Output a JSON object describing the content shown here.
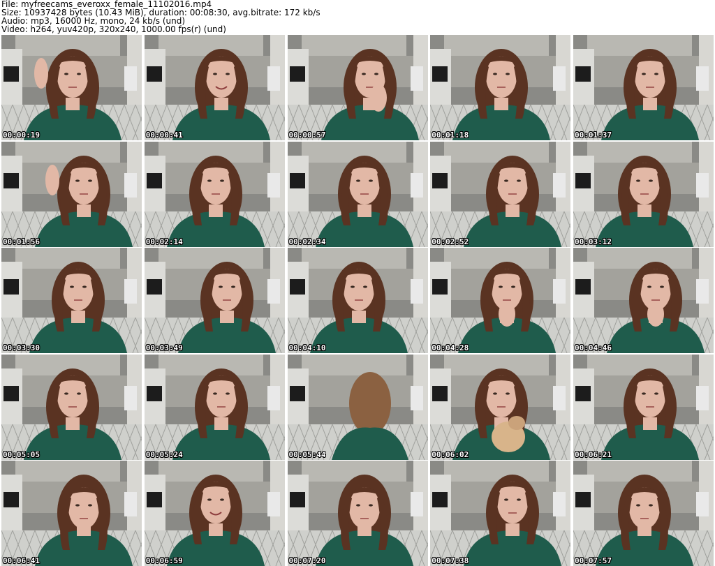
{
  "header": {
    "file_line": "File: myfreecams_everoxx_female_11102016.mp4",
    "size_line": "Size: 10937428 bytes (10.43 MiB), duration: 00:08:30, avg.bitrate: 172 kb/s",
    "audio_line": "Audio: mp3, 16000 Hz, mono, 24 kb/s (und)",
    "video_line": "Video: h264, yuv420p, 320x240, 1000.00 fps(r) (und)"
  },
  "thumbnails": [
    {
      "timestamp": "00:00:19",
      "pose": "hand-raised-left"
    },
    {
      "timestamp": "00:00:41",
      "pose": "smiling"
    },
    {
      "timestamp": "00:00:57",
      "pose": "hand-on-face"
    },
    {
      "timestamp": "00:01:18",
      "pose": "frown"
    },
    {
      "timestamp": "00:01:37",
      "pose": "side-glance"
    },
    {
      "timestamp": "00:01:56",
      "pose": "hand-on-head"
    },
    {
      "timestamp": "00:02:14",
      "pose": "looking-down"
    },
    {
      "timestamp": "00:02:34",
      "pose": "looking-down"
    },
    {
      "timestamp": "00:02:52",
      "pose": "looking-down"
    },
    {
      "timestamp": "00:03:12",
      "pose": "looking-down"
    },
    {
      "timestamp": "00:03:30",
      "pose": "looking-down"
    },
    {
      "timestamp": "00:03:49",
      "pose": "looking-down"
    },
    {
      "timestamp": "00:04:10",
      "pose": "looking-down"
    },
    {
      "timestamp": "00:04:28",
      "pose": "hand-at-mouth"
    },
    {
      "timestamp": "00:04:46",
      "pose": "hand-at-mouth"
    },
    {
      "timestamp": "00:05:05",
      "pose": "looking-down"
    },
    {
      "timestamp": "00:05:24",
      "pose": "looking-down"
    },
    {
      "timestamp": "00:05:44",
      "pose": "back-turned"
    },
    {
      "timestamp": "00:06:02",
      "pose": "holding-dog"
    },
    {
      "timestamp": "00:06:21",
      "pose": "looking-down"
    },
    {
      "timestamp": "00:06:41",
      "pose": "head-tilted-down"
    },
    {
      "timestamp": "00:06:59",
      "pose": "talking"
    },
    {
      "timestamp": "00:07:20",
      "pose": "head-tilted-down"
    },
    {
      "timestamp": "00:07:38",
      "pose": "looking-down"
    },
    {
      "timestamp": "00:07:57",
      "pose": "head-tilted-down"
    }
  ],
  "colors": {
    "background": "#ffffff",
    "timestamp_text": "#ffffff",
    "timestamp_outline": "#000000",
    "shirt": "#1f5c4c",
    "hair": "#5a3322",
    "skin": "#e2b8a6"
  }
}
